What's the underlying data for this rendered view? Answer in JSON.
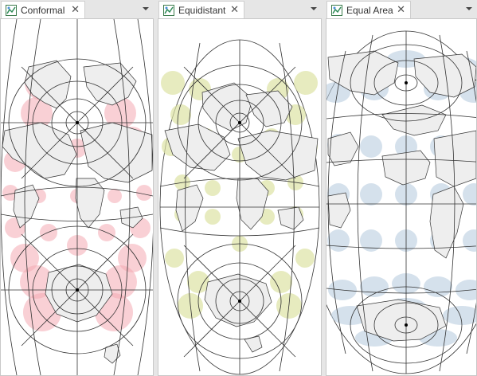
{
  "panes": [
    {
      "tab_label": "Conformal",
      "icon": "map-icon",
      "close_icon": "close-icon",
      "menu_icon": "chevron-down-icon"
    },
    {
      "tab_label": "Equidistant",
      "icon": "map-icon",
      "close_icon": "close-icon",
      "menu_icon": "chevron-down-icon"
    },
    {
      "tab_label": "Equal Area",
      "icon": "map-icon",
      "close_icon": "close-icon",
      "menu_icon": "chevron-down-icon"
    }
  ],
  "colors": {
    "conformal_indicatrix": "#f4a9b3",
    "equidistant_indicatrix": "#dde2a4",
    "equal_area_indicatrix": "#b9cde0",
    "land": "#eeeeee",
    "graticule": "#333333"
  }
}
